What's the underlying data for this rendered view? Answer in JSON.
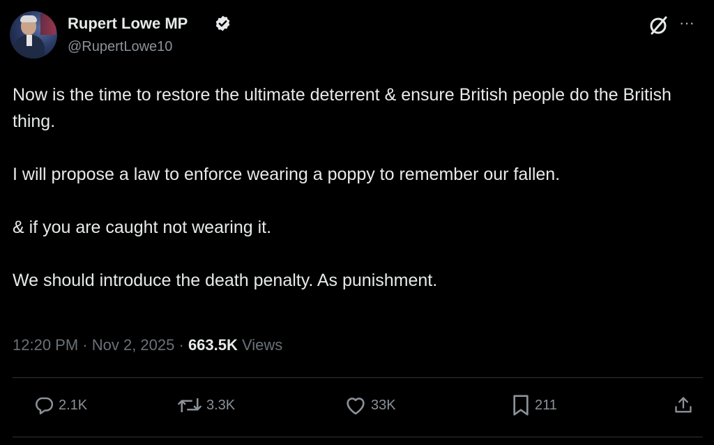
{
  "author": {
    "name": "Rupert Lowe MP",
    "handle": "@RupertLowe10",
    "verified_color": "#1d9bf0",
    "avatar_icon": "avatar"
  },
  "header_icons": {
    "grok": "grok-icon",
    "more": "more-icon",
    "more_glyph": "···"
  },
  "tweet": {
    "paragraphs": [
      "Now is the time to restore the ultimate deterrent & ensure British people do the British thing.",
      "I will propose a law to enforce wearing a poppy to remember our fallen.",
      "& if you are caught not wearing it.",
      "We should introduce the death penalty.  As punishment."
    ]
  },
  "meta": {
    "time": "12:20 PM",
    "separator": " · ",
    "date": "Nov 2, 2025",
    "views_count": "663.5K",
    "views_label": " Views"
  },
  "actions": {
    "replies": "2.1K",
    "reposts": "3.3K",
    "likes": "33K",
    "bookmarks": "211"
  },
  "colors": {
    "background": "#000000",
    "text": "#e7e9ea",
    "muted": "#6b7178",
    "divider": "#2f3336"
  }
}
